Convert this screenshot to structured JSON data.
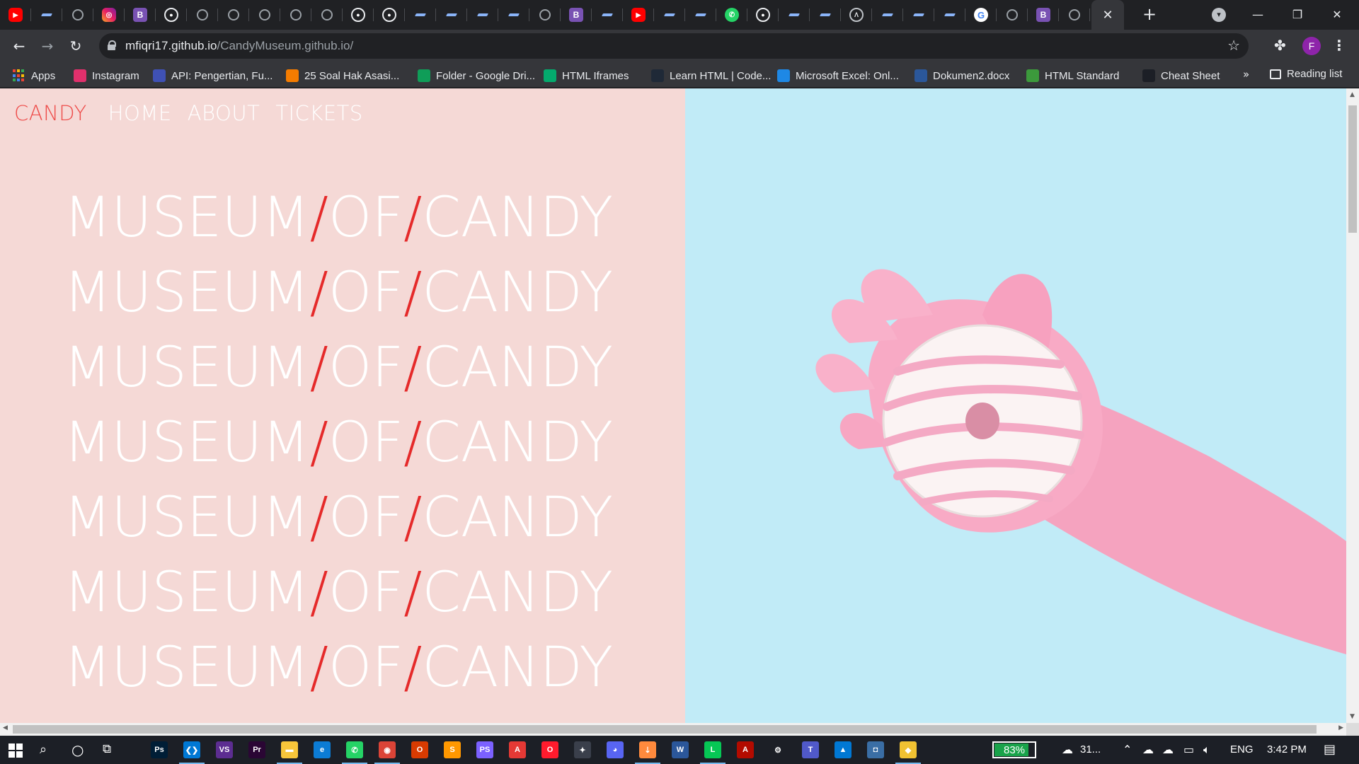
{
  "browser": {
    "tabs": [
      {
        "icon": "youtube-icon",
        "cls": "yt",
        "glyph": "▶"
      },
      {
        "icon": "dash-icon",
        "cls": "dash",
        "glyph": ""
      },
      {
        "icon": "globe-icon",
        "cls": "globe",
        "glyph": ""
      },
      {
        "icon": "instagram-icon",
        "cls": "ig",
        "glyph": "◎"
      },
      {
        "icon": "bootstrap-icon",
        "cls": "bs",
        "glyph": "B"
      },
      {
        "icon": "github-icon",
        "cls": "gh",
        "glyph": "●"
      },
      {
        "icon": "globe-icon",
        "cls": "globe",
        "glyph": ""
      },
      {
        "icon": "globe-icon",
        "cls": "globe",
        "glyph": ""
      },
      {
        "icon": "globe-icon",
        "cls": "globe",
        "glyph": ""
      },
      {
        "icon": "globe-icon",
        "cls": "globe",
        "glyph": ""
      },
      {
        "icon": "globe-icon",
        "cls": "globe",
        "glyph": ""
      },
      {
        "icon": "github-icon",
        "cls": "gh",
        "glyph": "●"
      },
      {
        "icon": "github-icon",
        "cls": "gh",
        "glyph": "●"
      },
      {
        "icon": "dash-icon",
        "cls": "dash",
        "glyph": ""
      },
      {
        "icon": "dash-icon",
        "cls": "dash",
        "glyph": ""
      },
      {
        "icon": "dash-icon",
        "cls": "dash",
        "glyph": ""
      },
      {
        "icon": "dash-icon",
        "cls": "dash",
        "glyph": ""
      },
      {
        "icon": "globe-icon",
        "cls": "globe",
        "glyph": ""
      },
      {
        "icon": "bootstrap-icon",
        "cls": "bs",
        "glyph": "B"
      },
      {
        "icon": "dash-icon",
        "cls": "dash",
        "glyph": ""
      },
      {
        "icon": "youtube-icon",
        "cls": "yt",
        "glyph": "▶"
      },
      {
        "icon": "dash-icon",
        "cls": "dash",
        "glyph": ""
      },
      {
        "icon": "dash-icon",
        "cls": "dash",
        "glyph": ""
      },
      {
        "icon": "whatsapp-icon",
        "cls": "wa",
        "glyph": "✆"
      },
      {
        "icon": "github-icon",
        "cls": "gh",
        "glyph": "●"
      },
      {
        "icon": "dash-icon",
        "cls": "dash",
        "glyph": ""
      },
      {
        "icon": "dash-icon",
        "cls": "dash",
        "glyph": ""
      },
      {
        "icon": "triangle-icon",
        "cls": "tri",
        "glyph": "Λ"
      },
      {
        "icon": "dash-icon",
        "cls": "dash",
        "glyph": ""
      },
      {
        "icon": "dash-icon",
        "cls": "dash",
        "glyph": ""
      },
      {
        "icon": "dash-icon",
        "cls": "dash",
        "glyph": ""
      },
      {
        "icon": "google-icon",
        "cls": "g",
        "glyph": "G"
      },
      {
        "icon": "globe-icon",
        "cls": "globe",
        "glyph": ""
      },
      {
        "icon": "bootstrap-icon",
        "cls": "bs",
        "glyph": "B"
      },
      {
        "icon": "globe-icon",
        "cls": "globe",
        "glyph": ""
      }
    ],
    "url_host": "mfiqri17.github.io",
    "url_path": "/CandyMuseum.github.io/",
    "profile_initial": "F",
    "bookmarks": [
      {
        "label": "Apps",
        "icon": "apps-grid-icon"
      },
      {
        "label": "Instagram",
        "icon": "instagram-icon",
        "color": "#e1306c"
      },
      {
        "label": "API: Pengertian, Fu...",
        "icon": "api-icon",
        "color": "#3f51b5"
      },
      {
        "label": "25 Soal Hak Asasi...",
        "icon": "blogger-icon",
        "color": "#f57c00"
      },
      {
        "label": "Folder - Google Dri...",
        "icon": "google-drive-icon",
        "color": "#0f9d58"
      },
      {
        "label": "HTML Iframes",
        "icon": "w3schools-icon",
        "color": "#04aa6d"
      },
      {
        "label": "Learn HTML | Code...",
        "icon": "codecademy-icon",
        "color": "#1f2937"
      },
      {
        "label": "Microsoft Excel: Onl...",
        "icon": "video-icon",
        "color": "#1e88e5"
      },
      {
        "label": "Dokumen2.docx",
        "icon": "word-icon",
        "color": "#2b579a"
      },
      {
        "label": "HTML Standard",
        "icon": "whatwg-icon",
        "color": "#3c9a3c"
      },
      {
        "label": "Cheat Sheet",
        "icon": "cheatsheet-icon",
        "color": "#1c1f26"
      }
    ],
    "bookmarks_more": "»",
    "reading_list": "Reading list"
  },
  "site": {
    "brand": "CANDY",
    "nav": [
      "HOME",
      "ABOUT",
      "TICKETS"
    ],
    "headline_rows": [
      [
        "MUSEUM",
        "/",
        "OF",
        "/",
        "CANDY"
      ],
      [
        "MUSEUM",
        "/",
        "OF",
        "/",
        "CANDY"
      ],
      [
        "MUSEUM",
        "/",
        "OF",
        "/",
        "CANDY"
      ],
      [
        "MUSEUM",
        "/",
        "OF",
        "/",
        "CANDY"
      ],
      [
        "MUSEUM",
        "/",
        "OF",
        "/",
        "CANDY"
      ],
      [
        "MUSEUM",
        "/",
        "OF",
        "/",
        "CANDY"
      ],
      [
        "MUSEUM",
        "/",
        "OF",
        "/",
        "CANDY"
      ]
    ],
    "hero_image": "pink-glove-holding-donut-image",
    "colors": {
      "left_bg": "#f5d9d6",
      "right_bg": "#c1ebf7",
      "brand": "#ee4c4a",
      "slash": "#e52a2a",
      "glove": "#f6a6c1",
      "donut_stripe": "#f4a9c4"
    }
  },
  "taskbar": {
    "apps": [
      {
        "icon": "photoshop-icon",
        "glyph": "Ps",
        "color": "#001e36",
        "running": false
      },
      {
        "icon": "vscode-icon",
        "glyph": "❮❯",
        "color": "#0078d4",
        "running": true
      },
      {
        "icon": "visual-studio-icon",
        "glyph": "VS",
        "color": "#5c2d91",
        "running": false
      },
      {
        "icon": "premiere-icon",
        "glyph": "Pr",
        "color": "#2a0634",
        "running": false
      },
      {
        "icon": "file-explorer-icon",
        "glyph": "▬",
        "color": "#f8c63a",
        "running": true
      },
      {
        "icon": "edge-icon",
        "glyph": "e",
        "color": "#0c7cd5",
        "running": false
      },
      {
        "icon": "whatsapp-icon",
        "glyph": "✆",
        "color": "#25d366",
        "running": true
      },
      {
        "icon": "chrome-icon",
        "glyph": "◉",
        "color": "#db4437",
        "running": true
      },
      {
        "icon": "office-icon",
        "glyph": "O",
        "color": "#d83b01",
        "running": false
      },
      {
        "icon": "sublime-icon",
        "glyph": "S",
        "color": "#ff9800",
        "running": false
      },
      {
        "icon": "phpstorm-icon",
        "glyph": "PS",
        "color": "#7b61ff",
        "running": false
      },
      {
        "icon": "adobe-icon",
        "glyph": "A",
        "color": "#e53935",
        "running": false
      },
      {
        "icon": "opera-icon",
        "glyph": "O",
        "color": "#ff1b2d",
        "running": false
      },
      {
        "icon": "bird-icon",
        "glyph": "✦",
        "color": "#3a3f4b",
        "running": false
      },
      {
        "icon": "discord-icon",
        "glyph": "◕",
        "color": "#5865f2",
        "running": false
      },
      {
        "icon": "sublime-merge-icon",
        "glyph": "⇣",
        "color": "#ff8a3d",
        "running": true
      },
      {
        "icon": "word-icon",
        "glyph": "W",
        "color": "#2b579a",
        "running": false
      },
      {
        "icon": "line-icon",
        "glyph": "L",
        "color": "#06c755",
        "running": true
      },
      {
        "icon": "acrobat-icon",
        "glyph": "A",
        "color": "#b30b00",
        "running": false
      },
      {
        "icon": "settings-gear-icon",
        "glyph": "⚙",
        "color": "#1c1f26",
        "running": false
      },
      {
        "icon": "teams-icon",
        "glyph": "T",
        "color": "#5059c9",
        "running": false
      },
      {
        "icon": "photos-icon",
        "glyph": "▲",
        "color": "#0078d4",
        "running": false
      },
      {
        "icon": "camera-icon",
        "glyph": "◘",
        "color": "#3a6ea5",
        "running": false
      },
      {
        "icon": "git-icon",
        "glyph": "◆",
        "color": "#f1c232",
        "running": true
      }
    ],
    "battery": "83%",
    "weather": "31...",
    "language": "ENG",
    "time": "3:42 PM"
  }
}
